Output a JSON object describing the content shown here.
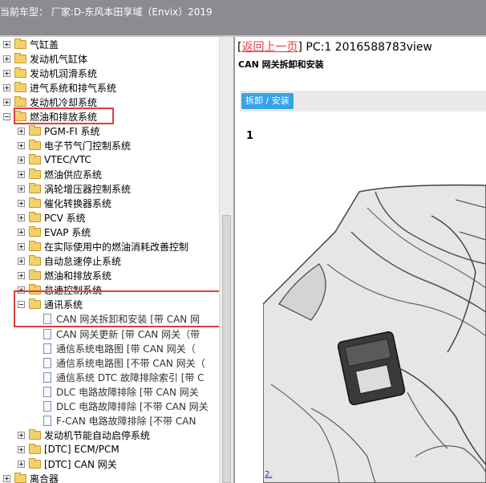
{
  "header": {
    "title": "当前车型： 厂家:D-东风本田享域（Envix）2019"
  },
  "tree": [
    {
      "label": "气缸盖",
      "level": 0,
      "expander": "plus",
      "icon": "folder"
    },
    {
      "label": "发动机气缸体",
      "level": 0,
      "expander": "plus",
      "icon": "folder"
    },
    {
      "label": "发动机润滑系统",
      "level": 0,
      "expander": "plus",
      "icon": "folder"
    },
    {
      "label": "进气系统和排气系统",
      "level": 0,
      "expander": "plus",
      "icon": "folder"
    },
    {
      "label": "发动机冷却系统",
      "level": 0,
      "expander": "plus",
      "icon": "folder"
    },
    {
      "label": "燃油和排放系统",
      "level": 0,
      "expander": "minus",
      "icon": "folder"
    },
    {
      "label": "PGM-FI 系统",
      "level": 1,
      "expander": "plus",
      "icon": "folder"
    },
    {
      "label": "电子节气门控制系统",
      "level": 1,
      "expander": "plus",
      "icon": "folder"
    },
    {
      "label": "VTEC/VTC",
      "level": 1,
      "expander": "plus",
      "icon": "folder"
    },
    {
      "label": "燃油供应系统",
      "level": 1,
      "expander": "plus",
      "icon": "folder"
    },
    {
      "label": "涡轮增压器控制系统",
      "level": 1,
      "expander": "plus",
      "icon": "folder"
    },
    {
      "label": "催化转换器系统",
      "level": 1,
      "expander": "plus",
      "icon": "folder"
    },
    {
      "label": "PCV 系统",
      "level": 1,
      "expander": "plus",
      "icon": "folder"
    },
    {
      "label": "EVAP 系统",
      "level": 1,
      "expander": "plus",
      "icon": "folder"
    },
    {
      "label": "在实际使用中的燃油消耗改善控制",
      "level": 1,
      "expander": "plus",
      "icon": "folder"
    },
    {
      "label": "自动怠速停止系统",
      "level": 1,
      "expander": "plus",
      "icon": "folder"
    },
    {
      "label": "燃油和排放系统",
      "level": 1,
      "expander": "plus",
      "icon": "folder"
    },
    {
      "label": "怠速控制系统",
      "level": 1,
      "expander": "plus",
      "icon": "folder"
    },
    {
      "label": "通讯系统",
      "level": 1,
      "expander": "minus",
      "icon": "folder"
    },
    {
      "label": "CAN 网关拆卸和安装 [带 CAN 网",
      "level": 2,
      "expander": "",
      "icon": "doc"
    },
    {
      "label": "CAN 网关更新 [带 CAN 网关（带",
      "level": 2,
      "expander": "",
      "icon": "doc"
    },
    {
      "label": "通信系统电路图 [带 CAN 网关（",
      "level": 2,
      "expander": "",
      "icon": "doc"
    },
    {
      "label": "通信系统电路图 [不带 CAN 网关（",
      "level": 2,
      "expander": "",
      "icon": "doc"
    },
    {
      "label": "通信系统 DTC 故障排除索引 [带 C",
      "level": 2,
      "expander": "",
      "icon": "doc"
    },
    {
      "label": "DLC 电路故障排除 [带 CAN 网关",
      "level": 2,
      "expander": "",
      "icon": "doc"
    },
    {
      "label": "DLC 电路故障排除 [不带 CAN 网关",
      "level": 2,
      "expander": "",
      "icon": "doc"
    },
    {
      "label": "F-CAN 电路故障排除 [不带 CAN",
      "level": 2,
      "expander": "",
      "icon": "doc"
    },
    {
      "label": "发动机节能自动启停系统",
      "level": 1,
      "expander": "plus",
      "icon": "folder"
    },
    {
      "label": "[DTC] ECM/PCM",
      "level": 1,
      "expander": "plus",
      "icon": "folder"
    },
    {
      "label": "[DTC] CAN 网关",
      "level": 1,
      "expander": "plus",
      "icon": "folder"
    },
    {
      "label": "离合器",
      "level": 0,
      "expander": "plus",
      "icon": "folder"
    }
  ],
  "content": {
    "back_link": "返回上一页",
    "page_info": "PC:1 2016588783view",
    "subtitle": "CAN 网关拆卸和安装",
    "tab_label": "拆卸 / 安装",
    "step_number": "1",
    "figure_callout": "2."
  },
  "colors": {
    "topbar": "#8c8c90",
    "highlight": "#e23b3b",
    "tab": "#35a4e6",
    "folder": "#f3d06a"
  }
}
